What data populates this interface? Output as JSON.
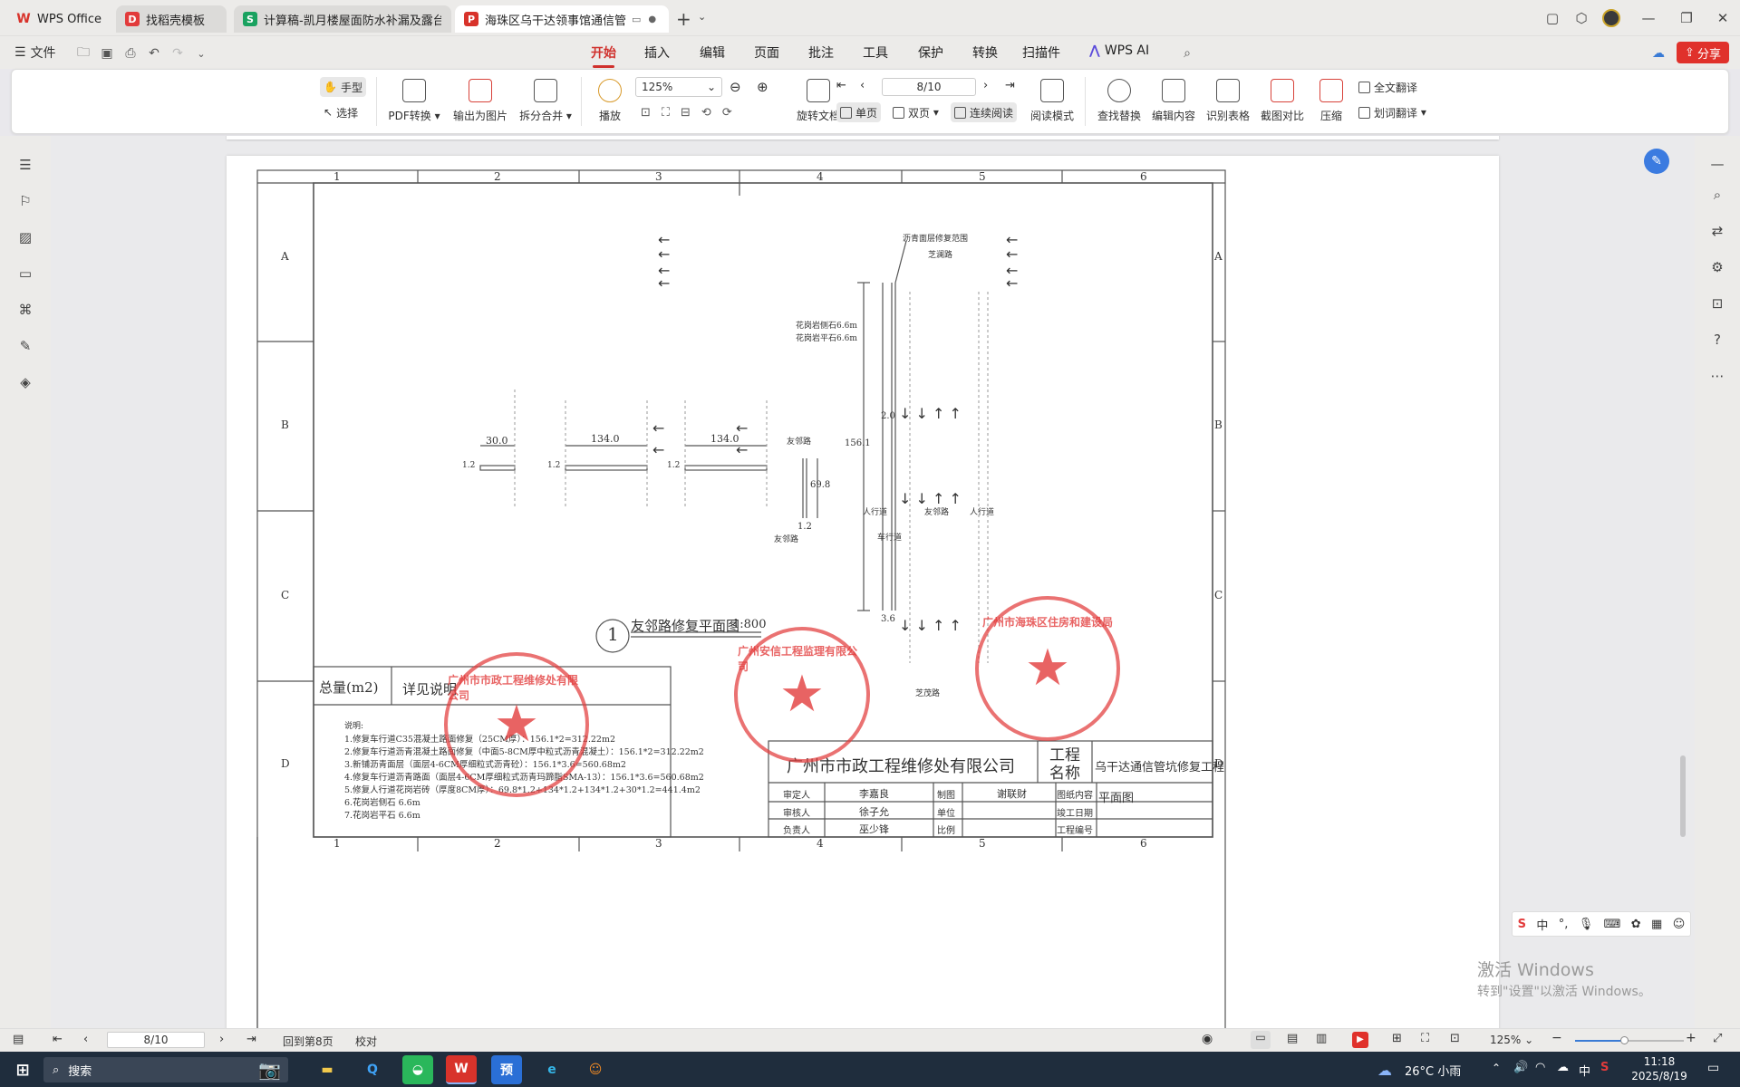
{
  "tabs": [
    {
      "label": "WPS Office",
      "icon": "wps-logo-icon",
      "color": "#d8332b"
    },
    {
      "label": "找稻壳模板",
      "icon": "docer-icon",
      "color": "#e23b3b"
    },
    {
      "label": "计算稿-凯月楼屋面防水补漏及露台地",
      "icon": "spreadsheet-icon",
      "color": "#1aa260"
    },
    {
      "label": "海珠区乌干达领事馆通信管坑",
      "icon": "pdf-icon",
      "color": "#d8332b"
    }
  ],
  "menu": {
    "file": "文件",
    "items": [
      "开始",
      "插入",
      "编辑",
      "页面",
      "批注",
      "工具",
      "保护",
      "转换",
      "扫描件"
    ],
    "active": "开始",
    "wps_ai": "WPS AI",
    "share": "分享"
  },
  "toolbar": {
    "hand": "手型",
    "select": "选择",
    "pdf_convert": "PDF转换",
    "export_image": "输出为图片",
    "split_merge": "拆分合并",
    "play": "播放",
    "zoom": "125%",
    "page_input": "8/10",
    "rotate": "旋转文档",
    "single": "单页",
    "double": "双页",
    "continuous": "连续阅读",
    "read_mode": "阅读模式",
    "find_replace": "查找替换",
    "edit_content": "编辑内容",
    "recognize_table": "识别表格",
    "compare": "截图对比",
    "compress": "压缩",
    "full_translate": "全文翻译",
    "word_translate": "划词翻译"
  },
  "drawing": {
    "col_numbers": [
      "1",
      "2",
      "3",
      "4",
      "5",
      "6"
    ],
    "row_letters": [
      "A",
      "B",
      "C",
      "D"
    ],
    "plan_title": "友邻路修复平面图",
    "scale": "1:800",
    "plan_number": "1",
    "dims": {
      "d30": "30.0",
      "d134a": "134.0",
      "d134b": "134.0",
      "d69": "69.8",
      "d156": "156.1",
      "d12": "1.2",
      "d20": "2.0",
      "d36": "3.6",
      "w12a": "1.2",
      "w12b": "1.2",
      "w12c": "1.2"
    },
    "labels": {
      "asphalt_range": "沥青面层修复范围",
      "zhilan": "芝澜路",
      "curb_side": "花岗岩侧石6.6m",
      "curb_flat": "花岗岩平石6.6m",
      "youlin": "友邻路",
      "youlin_side": "友邻路",
      "sidewalk_l": "人行道",
      "sidewalk_r": "人行道",
      "road_mid": "友邻路",
      "zhimao": "芝茂路",
      "lane": "车行道"
    },
    "qty_header": "总量(m2)",
    "qty_detail": "详见说明",
    "notes_title": "说明:",
    "notes": [
      "1.修复车行道C35混凝土路面修复（25CM厚）：156.1*2=312.22m2",
      "2.修复车行道沥青混凝土路面修复（中面5-8CM厚中粒式沥青混凝土）：156.1*2=312.22m2",
      "3.新铺沥青面层（面层4-6CM厚细粒式沥青砼）：156.1*3.6=560.68m2",
      "4.修复车行道沥青路面（面层4-6CM厚细粒式沥青玛蹄脂SMA-13）：156.1*3.6=560.68m2",
      "5.修复人行道花岗岩砖（厚度8CM厚）：69.8*1.2+134*1.2+134*1.2+30*1.2=441.4m2",
      "6.花岗岩侧石 6.6m",
      "7.花岗岩平石 6.6m"
    ],
    "title_block": {
      "company": "广州市市政工程维修处有限公司",
      "project_label": "工程名称",
      "project_name": "乌干达通信管坑修复工程",
      "rows": [
        {
          "k1": "审定人",
          "v1": "李嘉良",
          "k2": "制图",
          "v2": "谢联财",
          "k3": "图纸内容",
          "v3": "平面图"
        },
        {
          "k1": "审核人",
          "v1": "徐子允",
          "k2": "单位",
          "v2": "",
          "k3": "竣工日期",
          "v3": ""
        },
        {
          "k1": "负责人",
          "v1": "巫少锋",
          "k2": "比例",
          "v2": "",
          "k3": "工程编号",
          "v3": ""
        }
      ]
    },
    "stamps": {
      "s1": "广州市市政工程维修处有限公司",
      "s2": "广州安信工程监理有限公司",
      "s3": "广州市海珠区住房和建设局"
    }
  },
  "watermark": {
    "line1": "激活 Windows",
    "line2": "转到\"设置\"以激活 Windows。"
  },
  "statusbar": {
    "page": "8/10",
    "back_to": "回到第8页",
    "proof": "校对",
    "zoom": "125%"
  },
  "taskbar": {
    "search": "搜索",
    "weather": "26°C 小雨",
    "ime": "中",
    "time": "11:18",
    "date": "2025/8/19"
  },
  "ime_bar": {
    "lang": "中"
  }
}
